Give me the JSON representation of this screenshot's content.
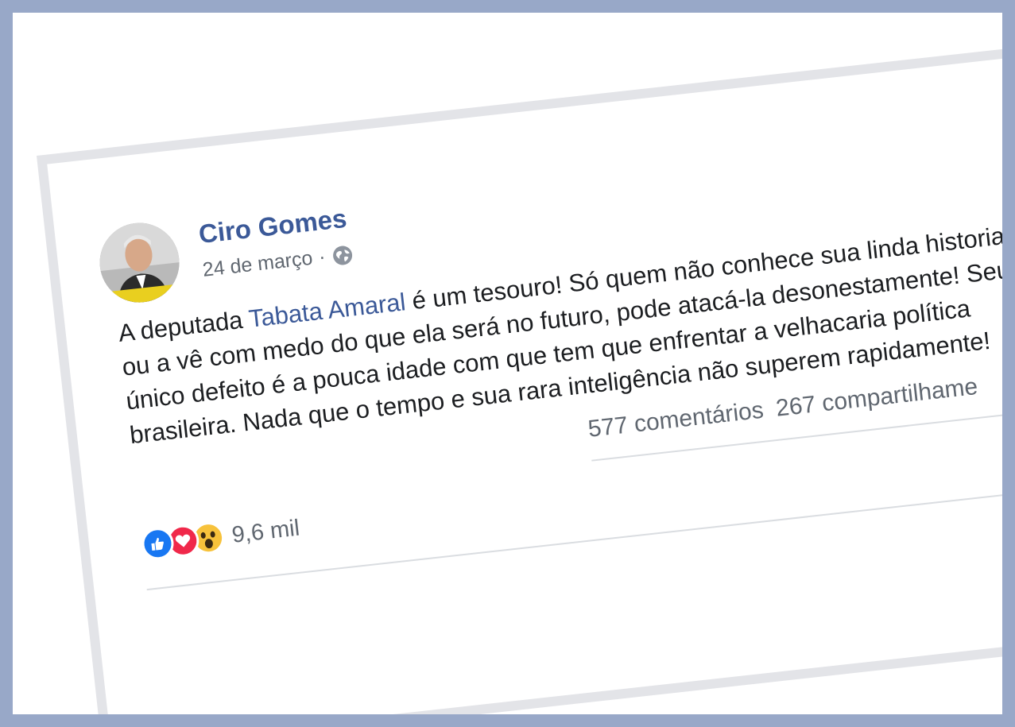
{
  "post": {
    "author": "Ciro Gomes",
    "date": "24 de março",
    "separator": "·",
    "privacy_icon": "globe-icon",
    "text_before_mention": "A deputada ",
    "mention": "Tabata Amaral",
    "text_after_mention": " é um tesouro! Só quem não conhece sua linda historia ou a vê com medo do que ela será no futuro, pode atacá-la desonestamente! Seu único defeito é a pouca idade com que tem que enfrentar a velhacaria política brasileira. Nada que o tempo e sua rara inteligência não superem rapidamente!"
  },
  "stats": {
    "comments": "577 comentários",
    "shares": "267 compartilhame"
  },
  "reactions": {
    "icons": [
      "like-icon",
      "love-icon",
      "wow-icon"
    ],
    "count": "9,6 mil"
  },
  "colors": {
    "brand": "#3b5998",
    "like": "#1877f2",
    "love": "#f0284a",
    "wow": "#f7c23b",
    "page_border": "#98a8c8"
  }
}
